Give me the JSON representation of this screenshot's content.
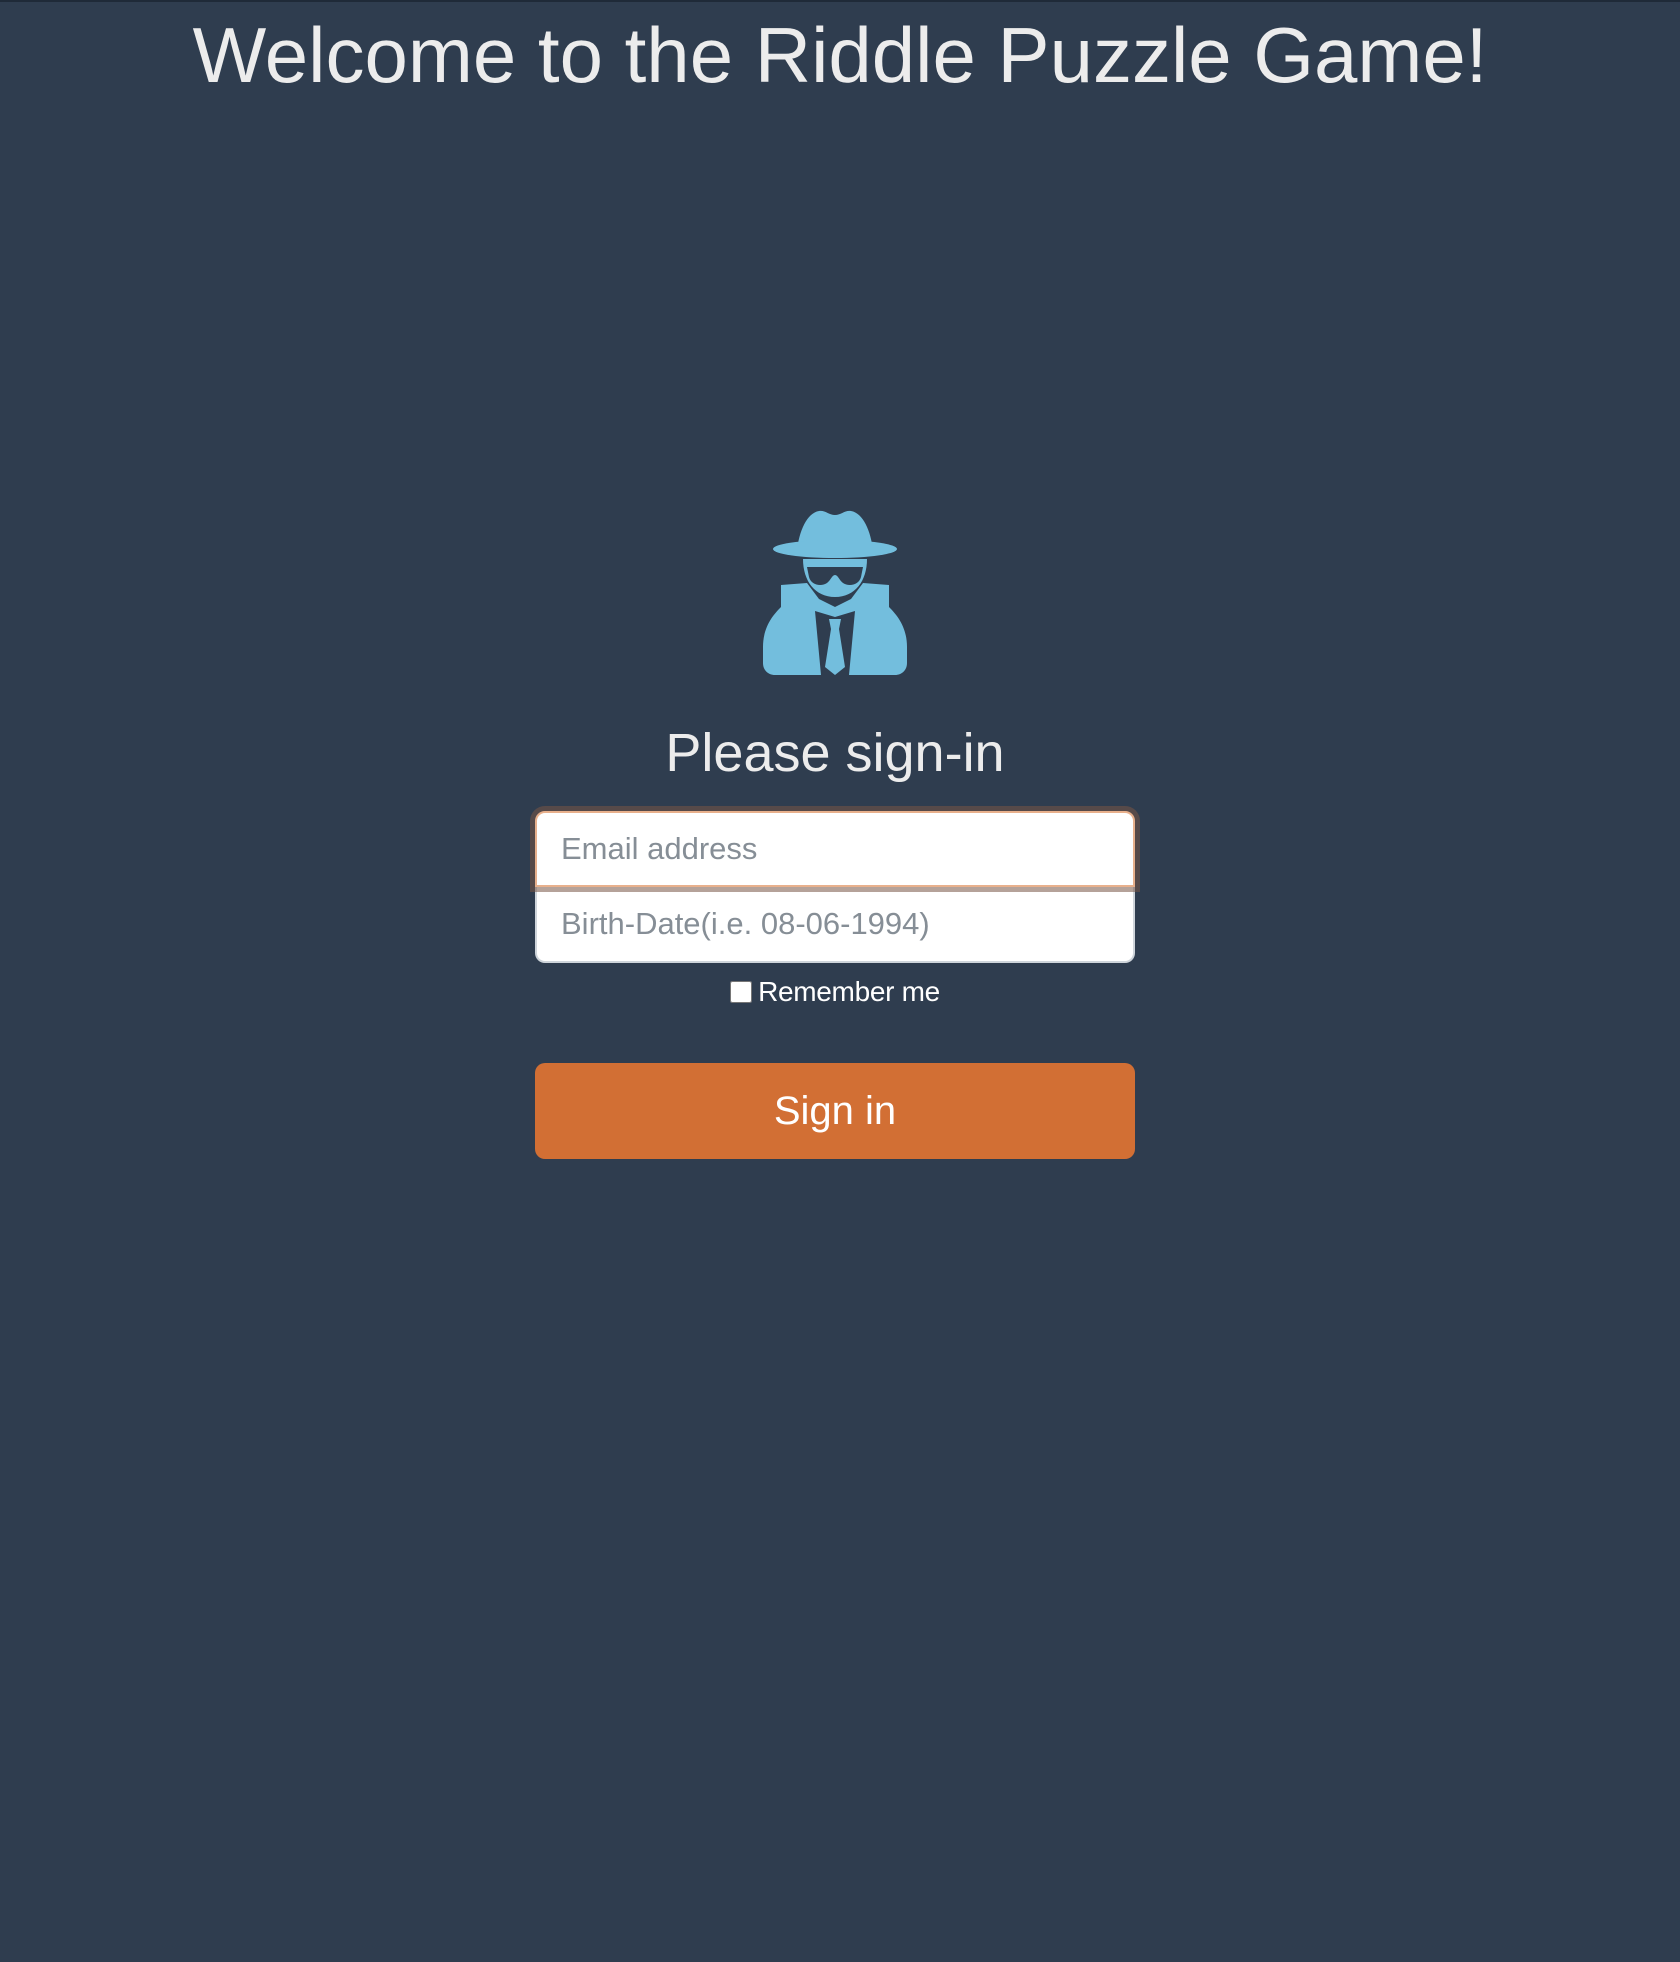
{
  "page": {
    "title": "Welcome to the Riddle Puzzle Game!"
  },
  "colors": {
    "background": "#2f3d4f",
    "accent": "#d26f34",
    "icon": "#73bedd",
    "text": "#ececec"
  },
  "signin_form": {
    "logo_icon": "user-secret-icon",
    "heading": "Please sign-in",
    "email": {
      "placeholder": "Email address",
      "value": ""
    },
    "birth_date": {
      "placeholder": "Birth-Date(i.e. 08-06-1994)",
      "value": ""
    },
    "remember_me": {
      "label": "Remember me",
      "checked": false
    },
    "submit_label": "Sign in"
  }
}
